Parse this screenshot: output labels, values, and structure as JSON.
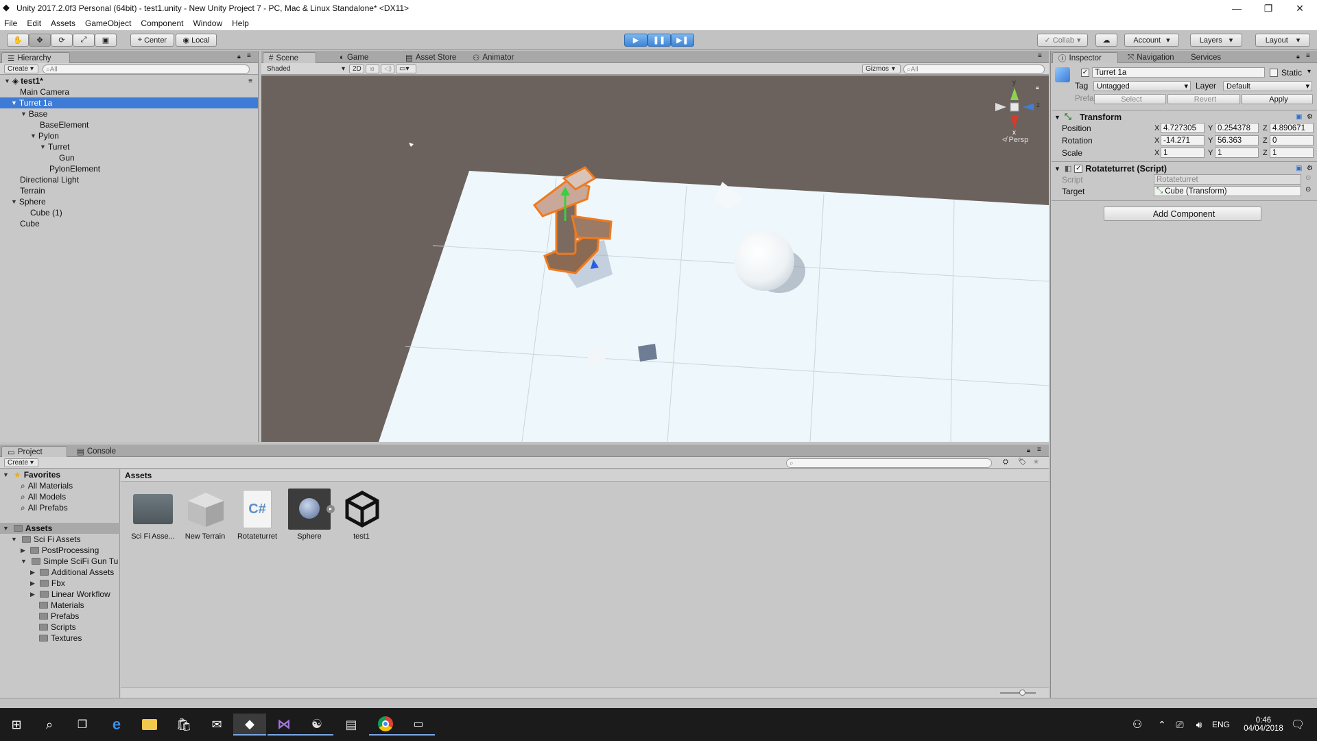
{
  "window": {
    "title": "Unity 2017.2.0f3 Personal (64bit) - test1.unity - New Unity Project 7 - PC, Mac & Linux Standalone* <DX11>"
  },
  "menu": [
    "File",
    "Edit",
    "Assets",
    "GameObject",
    "Component",
    "Window",
    "Help"
  ],
  "toolbar": {
    "center": "Center",
    "local": "Local",
    "collab": "Collab",
    "account": "Account",
    "layers": "Layers",
    "layout": "Layout"
  },
  "hierarchy": {
    "tab": "Hierarchy",
    "create": "Create",
    "search_placeholder": "All",
    "scene": "test1*",
    "items": [
      {
        "label": "Main Camera"
      },
      {
        "label": "Turret 1a"
      },
      {
        "label": "Base"
      },
      {
        "label": "BaseElement"
      },
      {
        "label": "Pylon"
      },
      {
        "label": "Turret"
      },
      {
        "label": "Gun"
      },
      {
        "label": "PylonElement"
      },
      {
        "label": "Directional Light"
      },
      {
        "label": "Terrain"
      },
      {
        "label": "Sphere"
      },
      {
        "label": "Cube (1)"
      },
      {
        "label": "Cube"
      }
    ]
  },
  "scene": {
    "tabs": [
      {
        "label": "Scene"
      },
      {
        "label": "Game"
      },
      {
        "label": "Asset Store"
      },
      {
        "label": "Animator"
      }
    ],
    "shading": "Shaded",
    "mode2d": "2D",
    "gizmos": "Gizmos",
    "search_placeholder": "All",
    "persp": "Persp",
    "axis_y": "y",
    "axis_z": "z",
    "axis_x": "x"
  },
  "project": {
    "tabs": [
      {
        "label": "Project"
      },
      {
        "label": "Console"
      }
    ],
    "create": "Create",
    "favorites": {
      "label": "Favorites",
      "items": [
        {
          "label": "All Materials"
        },
        {
          "label": "All Models"
        },
        {
          "label": "All Prefabs"
        }
      ]
    },
    "assets_root": "Assets",
    "tree": [
      {
        "label": "Sci Fi Assets"
      },
      {
        "label": "PostProcessing"
      },
      {
        "label": "Simple SciFi Gun Tu"
      },
      {
        "label": "Additional Assets"
      },
      {
        "label": "Fbx"
      },
      {
        "label": "Linear Workflow"
      },
      {
        "label": "Materials"
      },
      {
        "label": "Prefabs"
      },
      {
        "label": "Scripts"
      },
      {
        "label": "Textures"
      }
    ],
    "breadcrumb": "Assets",
    "assets": [
      {
        "label": "Sci Fi Asse..."
      },
      {
        "label": "New Terrain"
      },
      {
        "label": "Rotateturret"
      },
      {
        "label": "Sphere"
      },
      {
        "label": "test1"
      }
    ]
  },
  "inspector": {
    "tabs": [
      {
        "label": "Inspector"
      },
      {
        "label": "Navigation"
      },
      {
        "label": "Services"
      }
    ],
    "object_name": "Turret 1a",
    "static_label": "Static",
    "tag_label": "Tag",
    "tag_value": "Untagged",
    "layer_label": "Layer",
    "layer_value": "Default",
    "prefab_label": "Prefab",
    "select": "Select",
    "revert": "Revert",
    "apply": "Apply",
    "transform": {
      "title": "Transform",
      "position_label": "Position",
      "rotation_label": "Rotation",
      "scale_label": "Scale",
      "position": {
        "x": "4.727305",
        "y": "0.254378",
        "z": "4.890671"
      },
      "rotation": {
        "x": "-14.271",
        "y": "56.363",
        "z": "0"
      },
      "scale": {
        "x": "1",
        "y": "1",
        "z": "1"
      }
    },
    "script": {
      "title": "Rotateturret (Script)",
      "script_label": "Script",
      "script_value": "Rotateturret",
      "target_label": "Target",
      "target_value": "Cube (Transform)"
    },
    "add_component": "Add Component",
    "axis": {
      "x": "X",
      "y": "Y",
      "z": "Z"
    }
  },
  "taskbar": {
    "lang": "ENG",
    "time": "0:46",
    "date": "04/04/2018"
  },
  "colors": {
    "accent": "#3d7bd6",
    "selection_orange": "#f07a1e",
    "ground": "#eef7fb",
    "backdrop": "#6b625d"
  }
}
